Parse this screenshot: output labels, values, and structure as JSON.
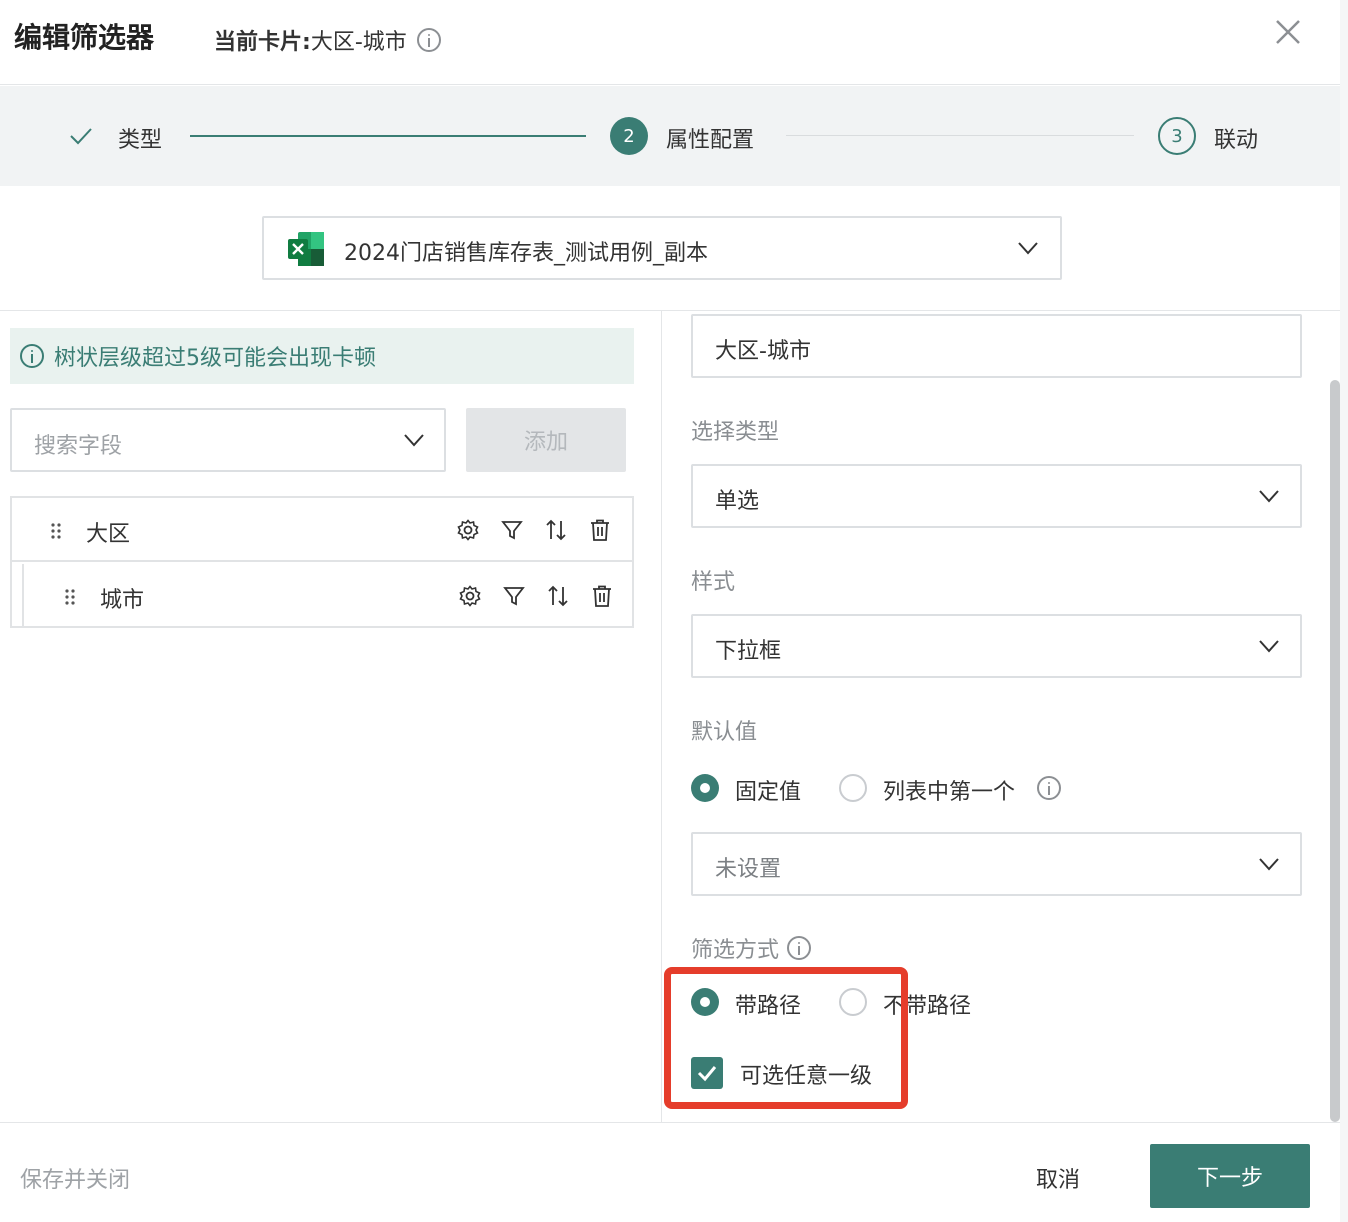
{
  "header": {
    "title": "编辑筛选器",
    "card_prefix": "当前卡片:",
    "card_name": "大区-城市"
  },
  "steps": [
    {
      "label": "类型",
      "state": "done"
    },
    {
      "label": "属性配置",
      "number": "2",
      "state": "active"
    },
    {
      "label": "联动",
      "number": "3",
      "state": "pending"
    }
  ],
  "datasource": {
    "name": "2024门店销售库存表_测试用例_副本",
    "icon": "excel-icon"
  },
  "left_panel": {
    "notice": "树状层级超过5级可能会出现卡顿",
    "search_placeholder": "搜索字段",
    "add_label": "添加",
    "tree": [
      {
        "label": "大区",
        "level": 1
      },
      {
        "label": "城市",
        "level": 2
      }
    ]
  },
  "right_panel": {
    "name_value": "大区-城市",
    "select_type_label": "选择类型",
    "select_type_value": "单选",
    "style_label": "样式",
    "style_value": "下拉框",
    "default_label": "默认值",
    "default_options": [
      "固定值",
      "列表中第一个"
    ],
    "default_selected": "固定值",
    "default_value_placeholder": "未设置",
    "filter_mode_label": "筛选方式",
    "filter_mode_options": [
      "带路径",
      "不带路径"
    ],
    "filter_mode_selected": "带路径",
    "any_level_label": "可选任意一级",
    "any_level_checked": true
  },
  "footer": {
    "save_close": "保存并关闭",
    "cancel": "取消",
    "next": "下一步"
  },
  "colors": {
    "accent": "#3a7d74",
    "highlight": "#e53d2b"
  }
}
